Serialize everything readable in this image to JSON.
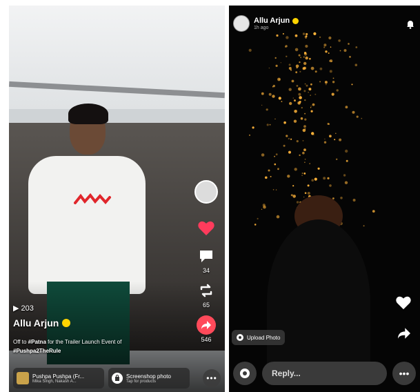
{
  "left_story": {
    "views": "203",
    "author": "Allu Arjun",
    "caption_prefix": "Off to",
    "caption_tag1": "#Patna",
    "caption_mid": "for the Trailer Launch Event of",
    "caption_tag2": "#Pushpa2TheRule",
    "comment_count": "34",
    "repost_count": "65",
    "share_count": "546",
    "chip_music_title": "Pushpa Pushpa (Fr...",
    "chip_music_sub": "Mika Singh, Nakash A...",
    "chip_shop_title": "Screenshop photo",
    "chip_shop_sub": "Tap for products",
    "more_glyph": "•••",
    "shirt_logo_color": "#e0262b",
    "like_color": "#ff3b5c"
  },
  "right_story": {
    "author": "Allu Arjun",
    "time": "1h ago",
    "upload_label": "Upload Photo",
    "reply_placeholder": "Reply...",
    "more_glyph": "•••",
    "spark_color": "#ffb43a"
  }
}
